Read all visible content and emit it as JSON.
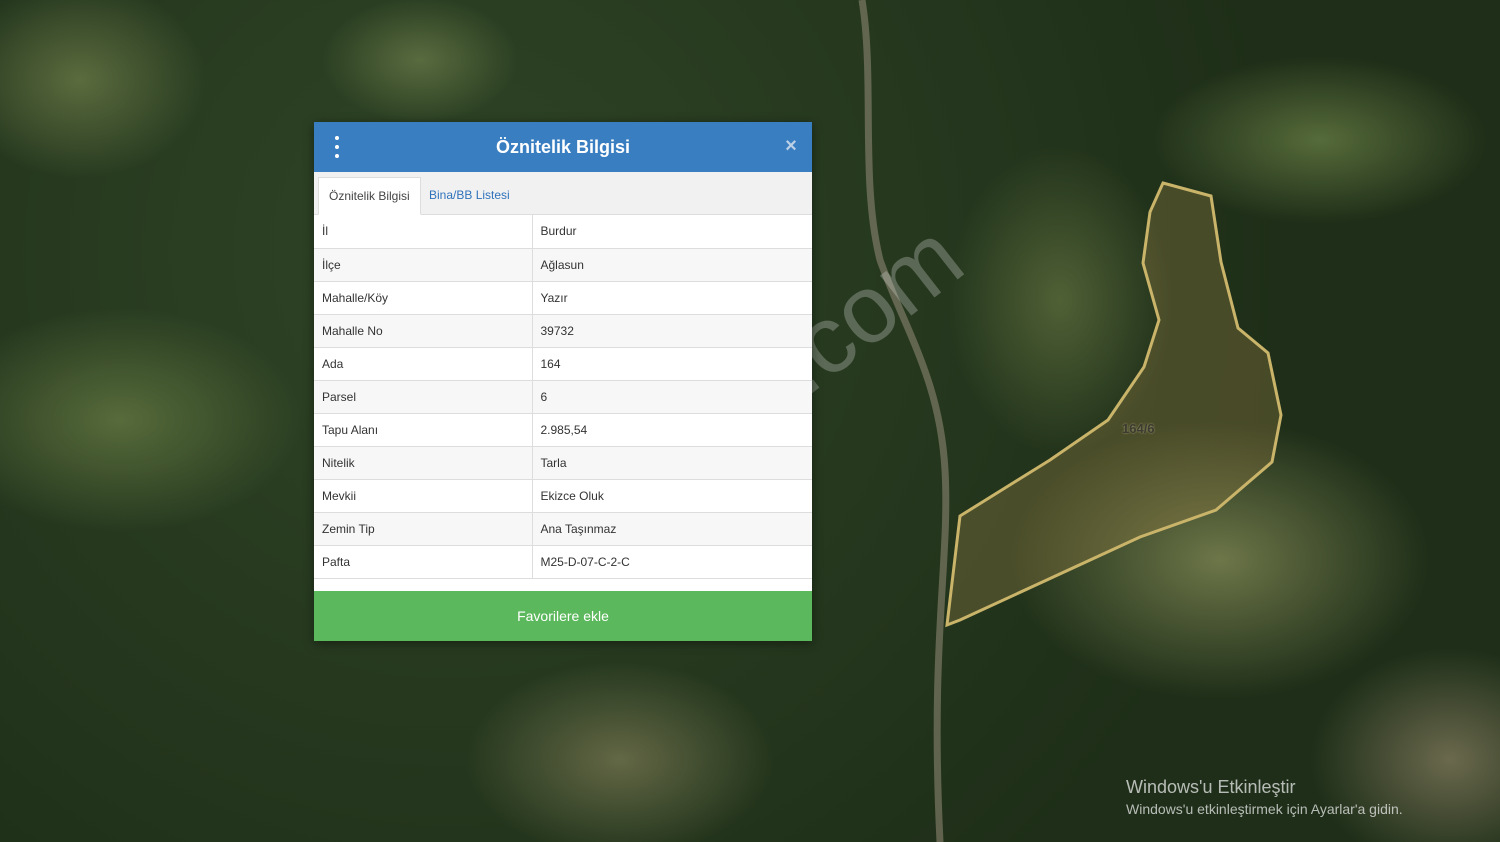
{
  "dialog": {
    "title": "Öznitelik Bilgisi",
    "tabs": [
      {
        "label": "Öznitelik Bilgisi",
        "active": true
      },
      {
        "label": "Bina/BB Listesi",
        "active": false
      }
    ],
    "rows": [
      {
        "key": "İl",
        "value": "Burdur"
      },
      {
        "key": "İlçe",
        "value": "Ağlasun"
      },
      {
        "key": "Mahalle/Köy",
        "value": "Yazır"
      },
      {
        "key": "Mahalle No",
        "value": "39732"
      },
      {
        "key": "Ada",
        "value": "164"
      },
      {
        "key": "Parsel",
        "value": "6"
      },
      {
        "key": "Tapu Alanı",
        "value": "2.985,54"
      },
      {
        "key": "Nitelik",
        "value": "Tarla"
      },
      {
        "key": "Mevkii",
        "value": "Ekizce Oluk"
      },
      {
        "key": "Zemin Tip",
        "value": "Ana Taşınmaz"
      },
      {
        "key": "Pafta",
        "value": "M25-D-07-C-2-C"
      }
    ],
    "favorite_label": "Favorilere ekle",
    "close_glyph": "×"
  },
  "map": {
    "parcel_label": "164/6",
    "watermark": "emlakjet.com"
  },
  "windows_activation": {
    "title": "Windows'u Etkinleştir",
    "subtitle": "Windows'u etkinleştirmek için Ayarlar'a gidin."
  },
  "colors": {
    "header": "#3a7ec2",
    "favorite_button": "#5cb85c",
    "parcel_outline": "#c9b46a",
    "tab_link": "#2f72bb"
  },
  "icons": [
    "more-vertical-icon",
    "close-icon"
  ]
}
